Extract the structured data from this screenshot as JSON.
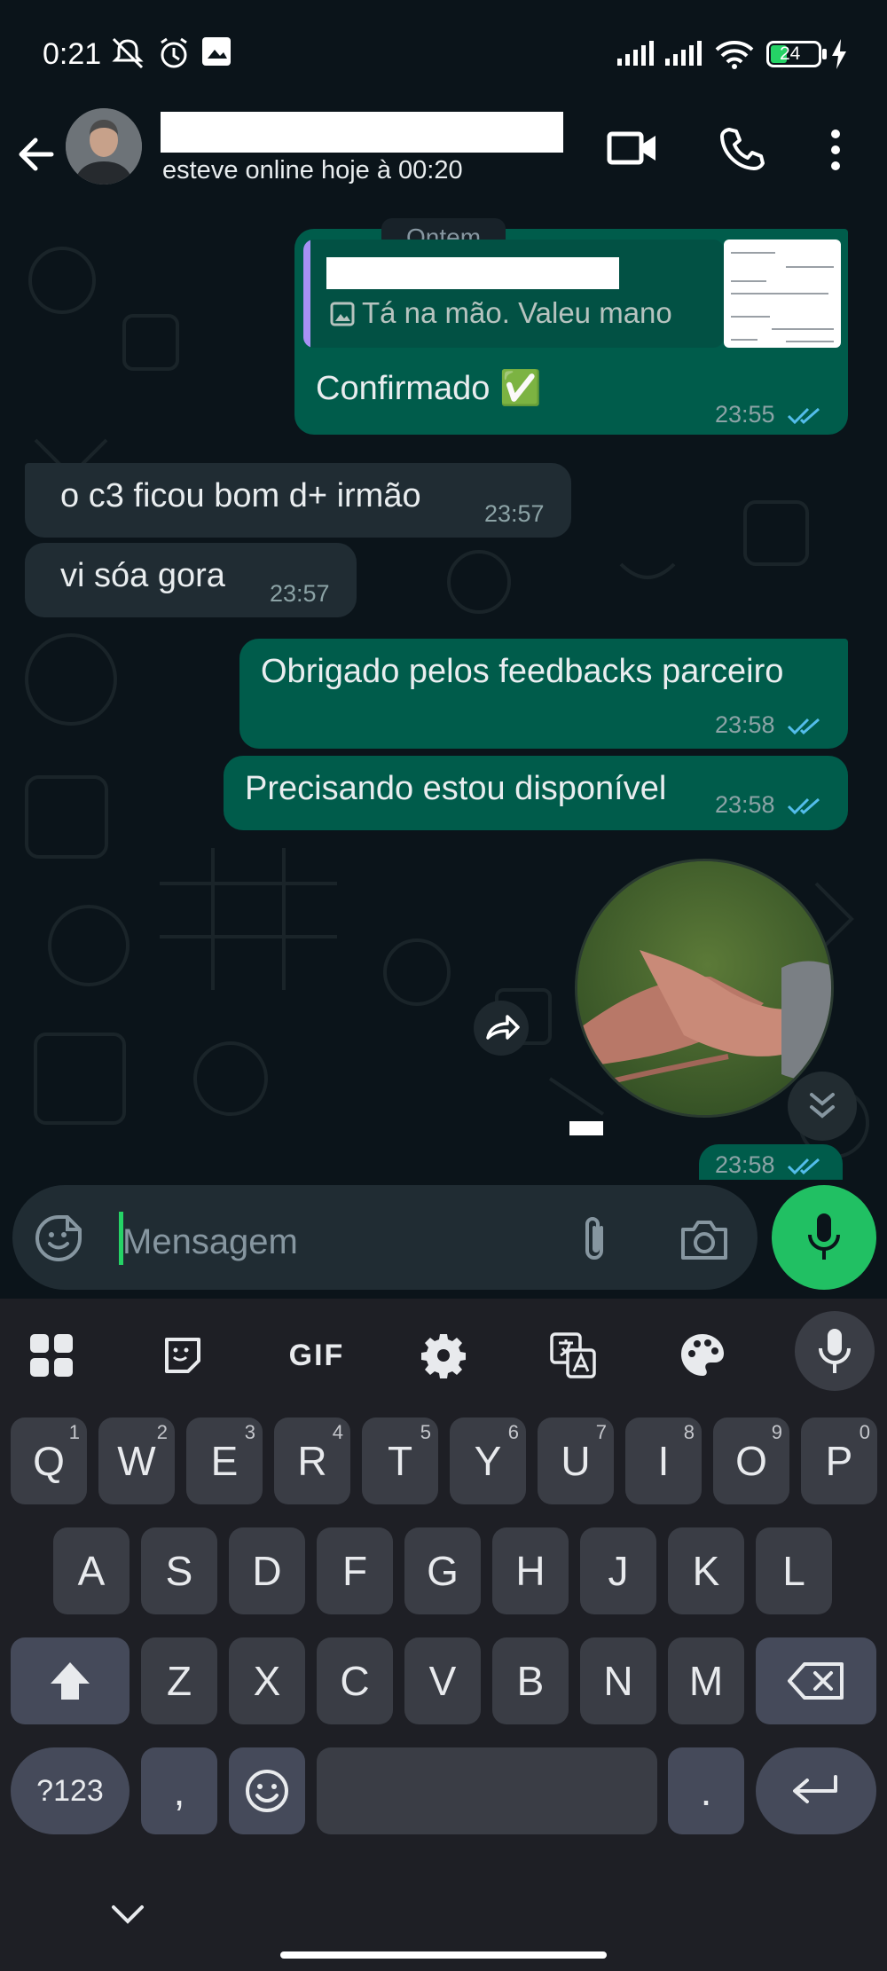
{
  "status_bar": {
    "time": "0:21",
    "battery": "24"
  },
  "header": {
    "last_seen": "esteve online hoje à 00:20"
  },
  "chat": {
    "date_chip": "Ontem",
    "quoted_text": "Tá na mão. Valeu mano",
    "messages": [
      {
        "dir": "out",
        "text": "Confirmado ✅",
        "time": "23:55"
      },
      {
        "dir": "in",
        "text": "o c3 ficou bom d+ irmão",
        "time": "23:57"
      },
      {
        "dir": "in",
        "text": "vi sóa gora",
        "time": "23:57"
      },
      {
        "dir": "out",
        "text": "Obrigado pelos feedbacks parceiro",
        "time": "23:58"
      },
      {
        "dir": "out",
        "text": "Precisando estou disponível",
        "time": "23:58"
      },
      {
        "dir": "out",
        "text": "",
        "time": "23:58"
      }
    ]
  },
  "input": {
    "placeholder": "Mensagem"
  },
  "keyboard": {
    "row1": [
      [
        "Q",
        "1"
      ],
      [
        "W",
        "2"
      ],
      [
        "E",
        "3"
      ],
      [
        "R",
        "4"
      ],
      [
        "T",
        "5"
      ],
      [
        "Y",
        "6"
      ],
      [
        "U",
        "7"
      ],
      [
        "I",
        "8"
      ],
      [
        "O",
        "9"
      ],
      [
        "P",
        "0"
      ]
    ],
    "row2": [
      "A",
      "S",
      "D",
      "F",
      "G",
      "H",
      "J",
      "K",
      "L"
    ],
    "row3": [
      "Z",
      "X",
      "C",
      "V",
      "B",
      "N",
      "M"
    ],
    "symbols_key": "?123",
    "comma_key": ",",
    "period_key": ".",
    "gif_label": "GIF"
  },
  "colors": {
    "outgoing": "#005c4b",
    "incoming": "#202c33",
    "accent": "#21c063",
    "tick_read": "#53bdeb"
  }
}
